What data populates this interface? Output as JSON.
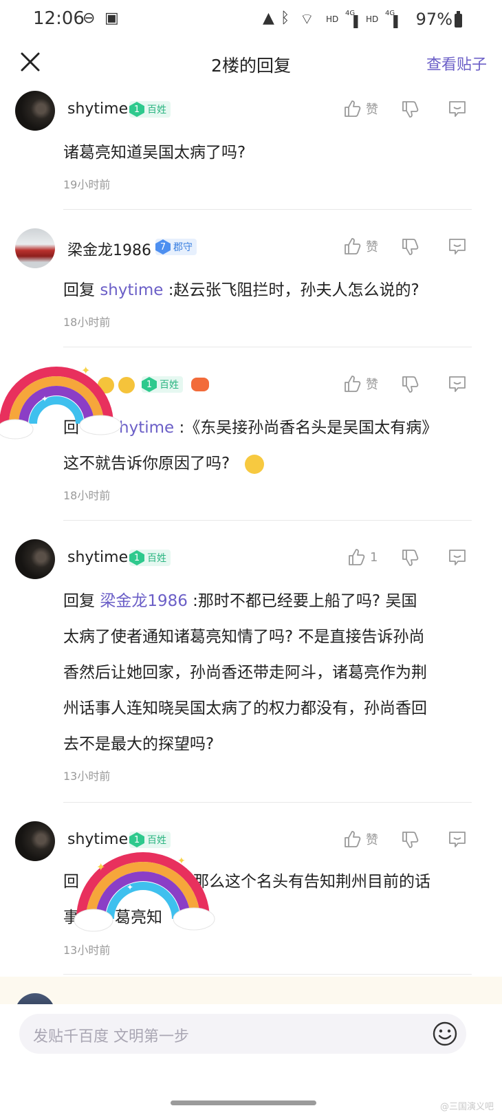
{
  "status_bar": {
    "time": "12:06",
    "network_1": "HD",
    "signal_1": "4G",
    "network_2": "HD",
    "signal_2": "4G",
    "battery": "97%"
  },
  "header": {
    "title": "2楼的回复",
    "view_post": "查看贴子"
  },
  "comments": [
    {
      "username": "shytime",
      "level": "1",
      "rank": "百姓",
      "like": "赞",
      "text": "诸葛亮知道吴国太病了吗?",
      "time": "19小时前"
    },
    {
      "username": "梁金龙1986",
      "level": "7",
      "rank": "郡守",
      "like": "赞",
      "reply_prefix": "回复",
      "mention": "shytime",
      "text": " :赵云张飞阻拦时，孙夫人怎么说的?",
      "time": "18小时前"
    },
    {
      "level": "1",
      "rank": "百姓",
      "like": "赞",
      "reply_prefix": "回",
      "mention": "hytime",
      "text_line1": " :《东吴接孙尚香名头是吴国太有病》",
      "text_line2": "这不就告诉你原因了吗?",
      "time": "18小时前"
    },
    {
      "username": "shytime",
      "level": "1",
      "rank": "百姓",
      "like_count": "1",
      "reply_prefix": "回复",
      "mention": "梁金龙1986",
      "lines": [
        " :那时不都已经要上船了吗? 吴国",
        "太病了使者通知诸葛亮知情了吗? 不是直接告诉孙尚",
        "香然后让她回家，孙尚香还带走阿斗，诸葛亮作为荆",
        "州话事人连知晓吴国太病了的权力都没有，孙尚香回",
        "去不是最大的探望吗?"
      ],
      "time": "13小时前"
    },
    {
      "username": "shytime",
      "level": "1",
      "rank": "百姓",
      "like": "赞",
      "text_line1_start": "回",
      "text_line1_end": "那么这个名头有告知荆州目前的话",
      "text_line2_start": "事",
      "text_line2_mid": "葛亮知",
      "text_line2_end": "?",
      "time": "13小时前"
    }
  ],
  "input": {
    "placeholder": "发贴千百度 文明第一步"
  },
  "watermark": "@三国演义吧"
}
